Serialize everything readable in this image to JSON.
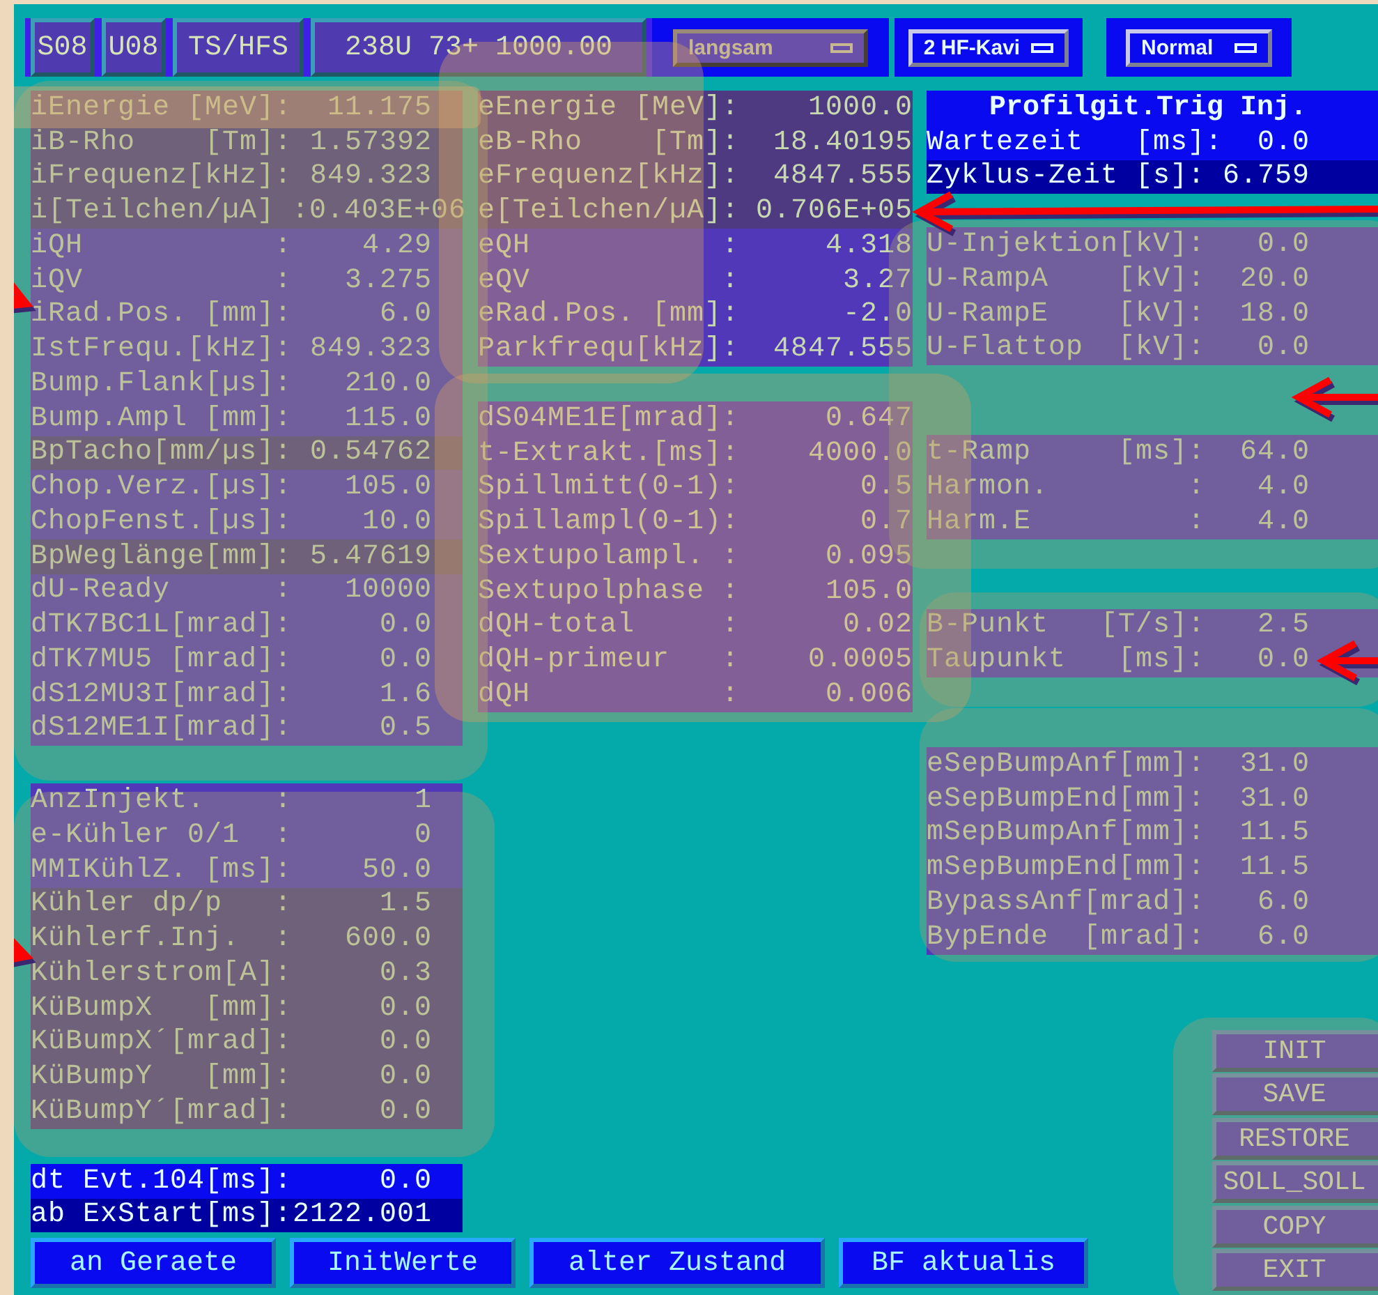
{
  "header": {
    "cells": [
      "S08",
      "U08",
      "TS/HFS",
      "238U 73+ 1000.00"
    ],
    "dropdowns": [
      {
        "label": "langsam",
        "disabled": true
      },
      {
        "label": "2 HF-Kavi",
        "disabled": false
      },
      {
        "label": "Normal",
        "disabled": false
      }
    ]
  },
  "left_column": {
    "sections": [
      {
        "rows": [
          {
            "label": "iEnergie [MeV]:",
            "value": "11.175",
            "kind": "dim"
          },
          {
            "label": "iB-Rho    [Tm]:",
            "value": "1.57392",
            "kind": "dim"
          },
          {
            "label": "iFrequenz[kHz]:",
            "value": "849.323",
            "kind": "dim"
          },
          {
            "label": "i[Teilchen/µA] :",
            "value": "0.403E+06",
            "kind": "dim"
          },
          {
            "label": "iQH           :",
            "value": "4.29",
            "kind": "plain"
          },
          {
            "label": "iQV           :",
            "value": "3.275",
            "kind": "plain"
          },
          {
            "label": "iRad.Pos. [mm]:",
            "value": "6.0",
            "kind": "plain"
          },
          {
            "label": "IstFrequ.[kHz]:",
            "value": "849.323",
            "kind": "plain"
          },
          {
            "label": "Bump.Flank[µs]:",
            "value": "210.0",
            "kind": "plain"
          },
          {
            "label": "Bump.Ampl [mm]:",
            "value": "115.0",
            "kind": "plain"
          },
          {
            "label": "BpTacho[mm/µs]:",
            "value": "0.54762",
            "kind": "dim"
          },
          {
            "label": "Chop.Verz.[µs]:",
            "value": "105.0",
            "kind": "plain"
          },
          {
            "label": "ChopFenst.[µs]:",
            "value": "10.0",
            "kind": "plain"
          },
          {
            "label": "BpWeglänge[mm]:",
            "value": "5.47619",
            "kind": "dim"
          },
          {
            "label": "dU-Ready      :",
            "value": "10000",
            "kind": "plain"
          },
          {
            "label": "dTK7BC1L[mrad]:",
            "value": "0.0",
            "kind": "plain"
          },
          {
            "label": "dTK7MU5 [mrad]:",
            "value": "0.0",
            "kind": "plain"
          },
          {
            "label": "dS12MU3I[mrad]:",
            "value": "1.6",
            "kind": "plain"
          },
          {
            "label": "dS12ME1I[mrad]:",
            "value": "0.5",
            "kind": "plain"
          }
        ]
      },
      {
        "rows": [
          {
            "label": "AnzInjekt.    :",
            "value": "1",
            "kind": "plain"
          },
          {
            "label": "e-Kühler 0/1  :",
            "value": "0",
            "kind": "plain"
          },
          {
            "label": "MMIKühlZ. [ms]:",
            "value": "50.0",
            "kind": "plain"
          },
          {
            "label": "Kühler dp/p   :",
            "value": "1.5",
            "kind": "dim"
          },
          {
            "label": "Kühlerf.Inj.  :",
            "value": "600.0",
            "kind": "dim"
          },
          {
            "label": "Kühlerstrom[A]:",
            "value": "0.3",
            "kind": "dim"
          },
          {
            "label": "KüBumpX   [mm]:",
            "value": "0.0",
            "kind": "dim"
          },
          {
            "label": "KüBumpX´[mrad]:",
            "value": "0.0",
            "kind": "dim"
          },
          {
            "label": "KüBumpY   [mm]:",
            "value": "0.0",
            "kind": "dim"
          },
          {
            "label": "KüBumpY´[mrad]:",
            "value": "0.0",
            "kind": "dim"
          }
        ]
      },
      {
        "rows": [
          {
            "label": "dt Evt.104[ms]:",
            "value": "0.0",
            "kind": "blue"
          },
          {
            "label": "ab ExStart[ms]:",
            "value": "2122.001",
            "kind": "navy"
          }
        ]
      }
    ]
  },
  "middle_column": {
    "sections": [
      {
        "rows": [
          {
            "label": "eEnergie [MeV]:",
            "value": "1000.0",
            "kind": "dim"
          },
          {
            "label": "eB-Rho    [Tm]:",
            "value": "18.40195",
            "kind": "dim"
          },
          {
            "label": "eFrequenz[kHz]:",
            "value": "4847.555",
            "kind": "dim"
          },
          {
            "label": "e[Teilchen/µA]:",
            "value": "0.706E+05",
            "kind": "dim"
          },
          {
            "label": "eQH           :",
            "value": "4.318",
            "kind": "plain"
          },
          {
            "label": "eQV           :",
            "value": "3.27",
            "kind": "plain"
          },
          {
            "label": "eRad.Pos. [mm]:",
            "value": "-2.0",
            "kind": "plain"
          },
          {
            "label": "Parkfrequ[kHz]:",
            "value": "4847.555",
            "kind": "plain"
          }
        ]
      },
      {
        "rows": [
          {
            "label": "dS04ME1E[mrad]:",
            "value": "0.647",
            "kind": "plain"
          },
          {
            "label": "t-Extrakt.[ms]:",
            "value": "4000.0",
            "kind": "plain"
          },
          {
            "label": "Spillmitt(0-1):",
            "value": "0.5",
            "kind": "plain"
          },
          {
            "label": "Spillampl(0-1):",
            "value": "0.7",
            "kind": "plain"
          },
          {
            "label": "Sextupolampl. :",
            "value": "0.095",
            "kind": "plain"
          },
          {
            "label": "Sextupolphase :",
            "value": "105.0",
            "kind": "plain"
          },
          {
            "label": "dQH-total     :",
            "value": "0.02",
            "kind": "plain"
          },
          {
            "label": "dQH-primeur   :",
            "value": "0.0005",
            "kind": "plain"
          },
          {
            "label": "dQH           :",
            "value": "0.006",
            "kind": "plain"
          }
        ]
      }
    ]
  },
  "right_column": {
    "title": "Profilgit.Trig Inj.",
    "sections": [
      {
        "rows": [
          {
            "label": "Wartezeit   [ms]:",
            "value": "0.0",
            "kind": "blue"
          },
          {
            "label": "Zyklus-Zeit [s]:",
            "value": "6.759",
            "kind": "navy"
          }
        ]
      },
      {
        "rows": [
          {
            "label": "U-Injektion[kV]:",
            "value": "0.0",
            "kind": "plain"
          },
          {
            "label": "U-RampA    [kV]:",
            "value": "20.0",
            "kind": "plain"
          },
          {
            "label": "U-RampE    [kV]:",
            "value": "18.0",
            "kind": "plain"
          },
          {
            "label": "U-Flattop  [kV]:",
            "value": "0.0",
            "kind": "plain"
          }
        ]
      },
      {
        "rows": [
          {
            "label": "t-Ramp     [ms]:",
            "value": "64.0",
            "kind": "plain"
          },
          {
            "label": "Harmon.        :",
            "value": "4.0",
            "kind": "plain"
          },
          {
            "label": "Harm.E         :",
            "value": "4.0",
            "kind": "plain"
          }
        ]
      },
      {
        "rows": [
          {
            "label": "B-Punkt   [T/s]:",
            "value": "2.5",
            "kind": "plain"
          },
          {
            "label": "Taupunkt   [ms]:",
            "value": "0.0",
            "kind": "plain"
          }
        ]
      },
      {
        "rows": [
          {
            "label": "eSepBumpAnf[mm]:",
            "value": "31.0",
            "kind": "plain"
          },
          {
            "label": "eSepBumpEnd[mm]:",
            "value": "31.0",
            "kind": "plain"
          },
          {
            "label": "mSepBumpAnf[mm]:",
            "value": "11.5",
            "kind": "plain"
          },
          {
            "label": "mSepBumpEnd[mm]:",
            "value": "11.5",
            "kind": "plain"
          },
          {
            "label": "BypassAnf[mrad]:",
            "value": "6.0",
            "kind": "plain"
          },
          {
            "label": "BypEnde  [mrad]:",
            "value": "6.0",
            "kind": "plain"
          }
        ]
      }
    ]
  },
  "side_buttons": [
    "INIT",
    "SAVE",
    "RESTORE",
    "SOLL_SOLL",
    "COPY",
    "EXIT"
  ],
  "bottom_buttons": [
    "an Geraete",
    "InitWerte",
    "alter Zustand",
    "BF aktualis"
  ]
}
